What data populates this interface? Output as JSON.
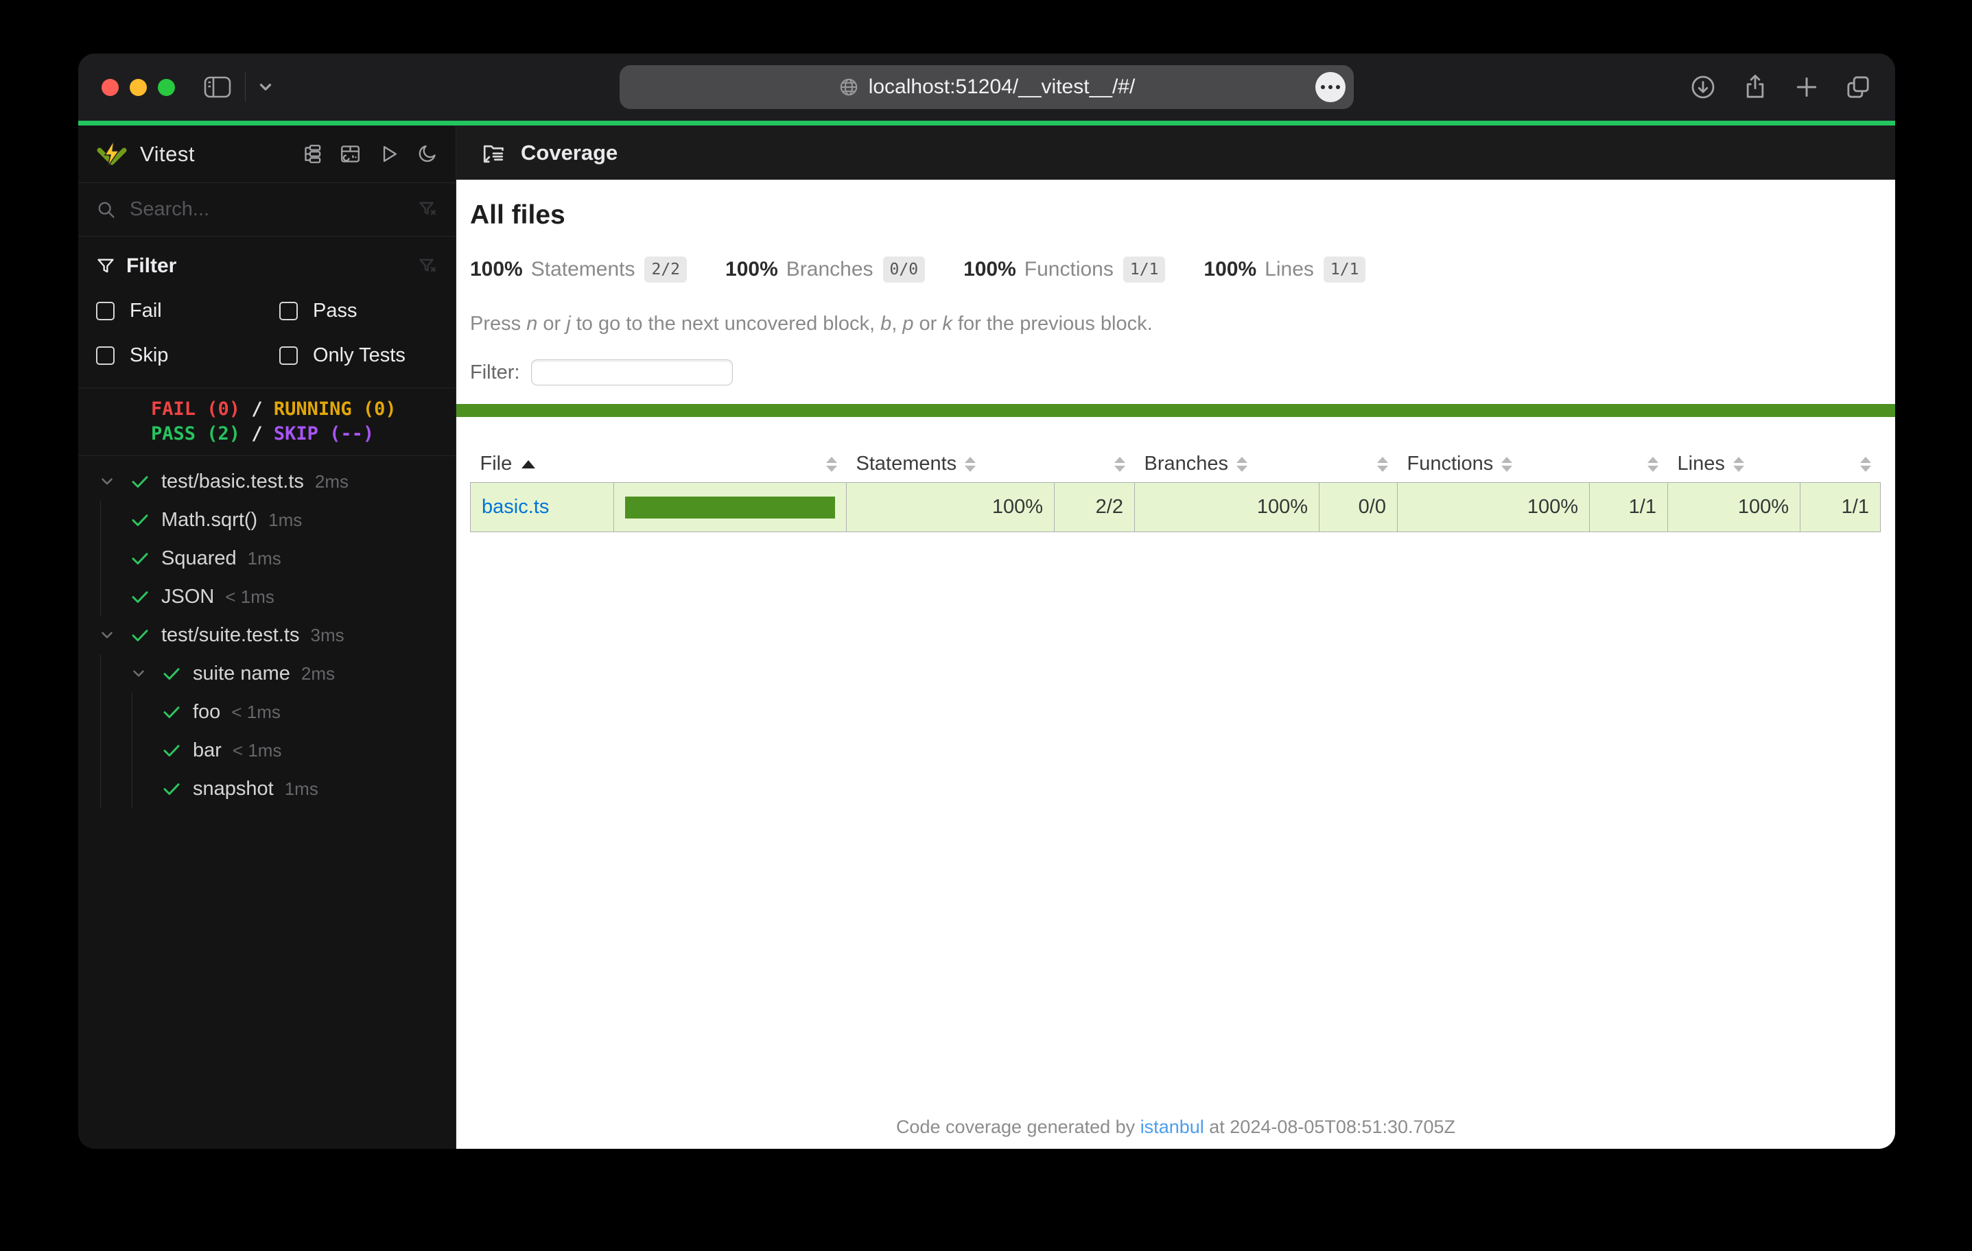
{
  "browser": {
    "url": "localhost:51204/__vitest__/#/",
    "window_controls": [
      "close",
      "minimize",
      "zoom"
    ],
    "toolbar_icons": [
      "sidebar-toggle-icon",
      "chevron-down-icon",
      "globe-icon",
      "more-icon",
      "download-icon",
      "share-icon",
      "new-tab-icon",
      "tab-overview-icon"
    ]
  },
  "colors": {
    "accent_green": "#22c55e",
    "coverage_green": "#4d9221",
    "coverage_row_bg": "#e6f5d0",
    "link_blue": "#0074d9",
    "fail_red": "#ef4444",
    "running_yellow": "#e2a709",
    "pass_green": "#26c45f",
    "skip_purple": "#a855f7"
  },
  "sidebar": {
    "title": "Vitest",
    "header_icons": [
      "tree-view-icon",
      "dashboard-icon",
      "run-all-icon",
      "dark-mode-icon"
    ],
    "search": {
      "placeholder": "Search..."
    },
    "filter": {
      "label": "Filter",
      "options": [
        {
          "label": "Fail",
          "checked": false
        },
        {
          "label": "Pass",
          "checked": false
        },
        {
          "label": "Skip",
          "checked": false
        },
        {
          "label": "Only Tests",
          "checked": false
        }
      ]
    },
    "status": {
      "fail": "FAIL (0)",
      "sep": "/",
      "running": "RUNNING (0)",
      "pass": "PASS (2)",
      "skip": "SKIP (--)"
    },
    "tree": {
      "items": [
        {
          "label": "test/basic.test.ts",
          "duration": "2ms",
          "level": 0,
          "expandable": true,
          "state": "pass"
        },
        {
          "label": "Math.sqrt()",
          "duration": "1ms",
          "level": 1,
          "expandable": false,
          "state": "pass"
        },
        {
          "label": "Squared",
          "duration": "1ms",
          "level": 1,
          "expandable": false,
          "state": "pass"
        },
        {
          "label": "JSON",
          "duration": "< 1ms",
          "level": 1,
          "expandable": false,
          "state": "pass"
        },
        {
          "label": "test/suite.test.ts",
          "duration": "3ms",
          "level": 0,
          "expandable": true,
          "state": "pass"
        },
        {
          "label": "suite name",
          "duration": "2ms",
          "level": 1,
          "expandable": true,
          "state": "pass"
        },
        {
          "label": "foo",
          "duration": "< 1ms",
          "level": 2,
          "expandable": false,
          "state": "pass"
        },
        {
          "label": "bar",
          "duration": "< 1ms",
          "level": 2,
          "expandable": false,
          "state": "pass"
        },
        {
          "label": "snapshot",
          "duration": "1ms",
          "level": 2,
          "expandable": false,
          "state": "pass"
        }
      ]
    }
  },
  "main": {
    "header": {
      "title": "Coverage"
    },
    "all_files": "All files",
    "stats": [
      {
        "pct": "100%",
        "label": "Statements",
        "fraction": "2/2"
      },
      {
        "pct": "100%",
        "label": "Branches",
        "fraction": "0/0"
      },
      {
        "pct": "100%",
        "label": "Functions",
        "fraction": "1/1"
      },
      {
        "pct": "100%",
        "label": "Lines",
        "fraction": "1/1"
      }
    ],
    "hint": {
      "p0": "Press ",
      "k0": "n",
      "p1": " or ",
      "k1": "j",
      "p2": " to go to the next uncovered block, ",
      "k2": "b",
      "p3": ", ",
      "k3": "p",
      "p4": " or ",
      "k4": "k",
      "p5": " for the previous block."
    },
    "filter": {
      "label": "Filter:",
      "value": "",
      "placeholder": ""
    },
    "table": {
      "headers": {
        "file": "File",
        "statements": "Statements",
        "branches": "Branches",
        "functions": "Functions",
        "lines": "Lines"
      },
      "sort": {
        "column": "file",
        "direction": "asc"
      },
      "rows": [
        {
          "file": "basic.ts",
          "coverage_bar_pct": 100,
          "statements_pct": "100%",
          "statements": "2/2",
          "branches_pct": "100%",
          "branches": "0/0",
          "functions_pct": "100%",
          "functions": "1/1",
          "lines_pct": "100%",
          "lines": "1/1"
        }
      ]
    },
    "footer": {
      "prefix": "Code coverage generated by ",
      "link": "istanbul",
      "suffix": " at 2024-08-05T08:51:30.705Z"
    }
  }
}
